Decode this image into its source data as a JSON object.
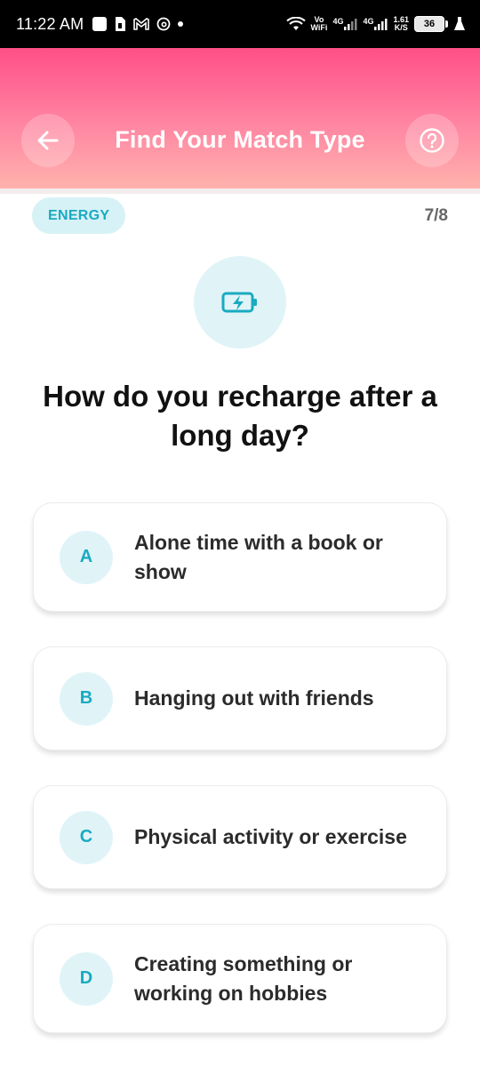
{
  "status_bar": {
    "time": "11:22 AM",
    "left_icons": [
      "square-notification-icon",
      "sim-icon",
      "gmail-icon",
      "threads-icon",
      "dot-icon"
    ],
    "vo_wifi_top": "Vo",
    "vo_wifi_bottom": "WiFi",
    "net1": "4G",
    "net2": "4G",
    "speed_top": "1.61",
    "speed_bottom": "K/S",
    "battery": "36"
  },
  "header": {
    "title": "Find Your Match Type",
    "back_icon": "arrow-left-icon",
    "help_icon": "question-circle-icon",
    "gradient_top": "#ff4f88",
    "gradient_bottom": "#ffb2ad"
  },
  "category": {
    "label": "ENERGY",
    "progress": "7/8",
    "icon": "battery-charging-icon",
    "accent": "#1aaac1"
  },
  "question": "How do you recharge after a long day?",
  "options": [
    {
      "letter": "A",
      "text": "Alone time with a book or show"
    },
    {
      "letter": "B",
      "text": "Hanging out with friends"
    },
    {
      "letter": "C",
      "text": "Physical activity or exercise"
    },
    {
      "letter": "D",
      "text": "Creating something or working on hobbies"
    }
  ]
}
